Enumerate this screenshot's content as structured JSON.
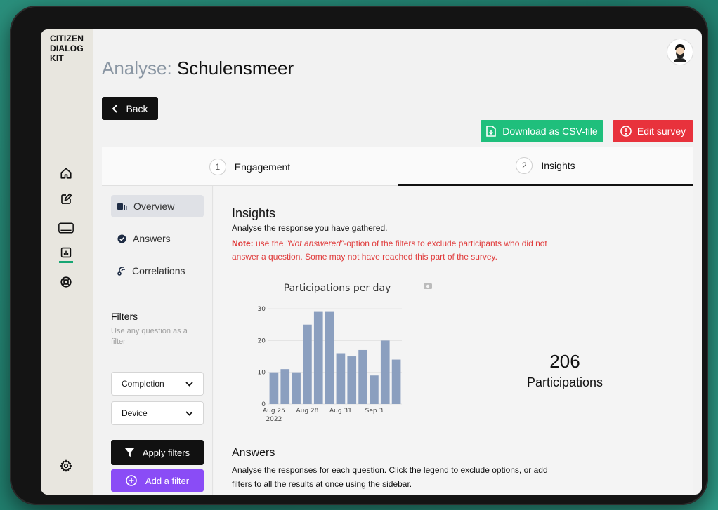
{
  "app": {
    "logo_lines": [
      "CITIZEN",
      "DIALOG",
      "KIT"
    ]
  },
  "header": {
    "title_prefix": "Analyse:",
    "title_name": "Schulensmeer"
  },
  "buttons": {
    "back": "Back",
    "download_csv": "Download as CSV-file",
    "edit_survey": "Edit survey",
    "apply_filters": "Apply filters",
    "add_filter": "Add a filter"
  },
  "tabs": [
    {
      "num": "1",
      "label": "Engagement"
    },
    {
      "num": "2",
      "label": "Insights"
    }
  ],
  "sidebar": {
    "items": [
      {
        "label": "Overview"
      },
      {
        "label": "Answers"
      },
      {
        "label": "Correlations"
      }
    ],
    "filters_title": "Filters",
    "filters_sub": "Use any question as a filter",
    "selects": [
      "Completion",
      "Device"
    ]
  },
  "insights": {
    "title": "Insights",
    "subtitle": "Analyse the response you have gathered.",
    "note_label": "Note:",
    "note_pre": " use the ",
    "note_italic": "\"Not answered\"",
    "note_post": "-option of the filters to exclude participants who did not answer a question. Some may not have reached this part of the survey."
  },
  "stats": {
    "count": "206",
    "label": "Participations"
  },
  "answers": {
    "title": "Answers",
    "text": "Analyse the responses for each question. Click the legend to exclude options, or add filters to all the results at once using the sidebar."
  },
  "colors": {
    "bar": "#8b9fbf",
    "csv": "#1fbf7c",
    "edit": "#e8323c",
    "add": "#8a4cf6",
    "active_rail": "#17a673"
  },
  "chart_data": {
    "type": "bar",
    "title": "Participations per day",
    "x": [
      "2022-08-25",
      "2022-08-26",
      "2022-08-27",
      "2022-08-28",
      "2022-08-29",
      "2022-08-30",
      "2022-08-31",
      "2022-09-01",
      "2022-09-02",
      "2022-09-03",
      "2022-09-04",
      "2022-09-05"
    ],
    "values": [
      10,
      11,
      10,
      25,
      29,
      29,
      16,
      15,
      17,
      9,
      20,
      14
    ],
    "ylim": [
      0,
      32
    ],
    "yticks": [
      "0",
      "10",
      "20",
      "30"
    ],
    "xtick_labels": [
      "Aug 25",
      "Aug 28",
      "Aug 31",
      "Sep 3"
    ],
    "xtick_index": [
      0,
      3,
      6,
      9
    ],
    "year_label": "2022",
    "grid": true
  }
}
